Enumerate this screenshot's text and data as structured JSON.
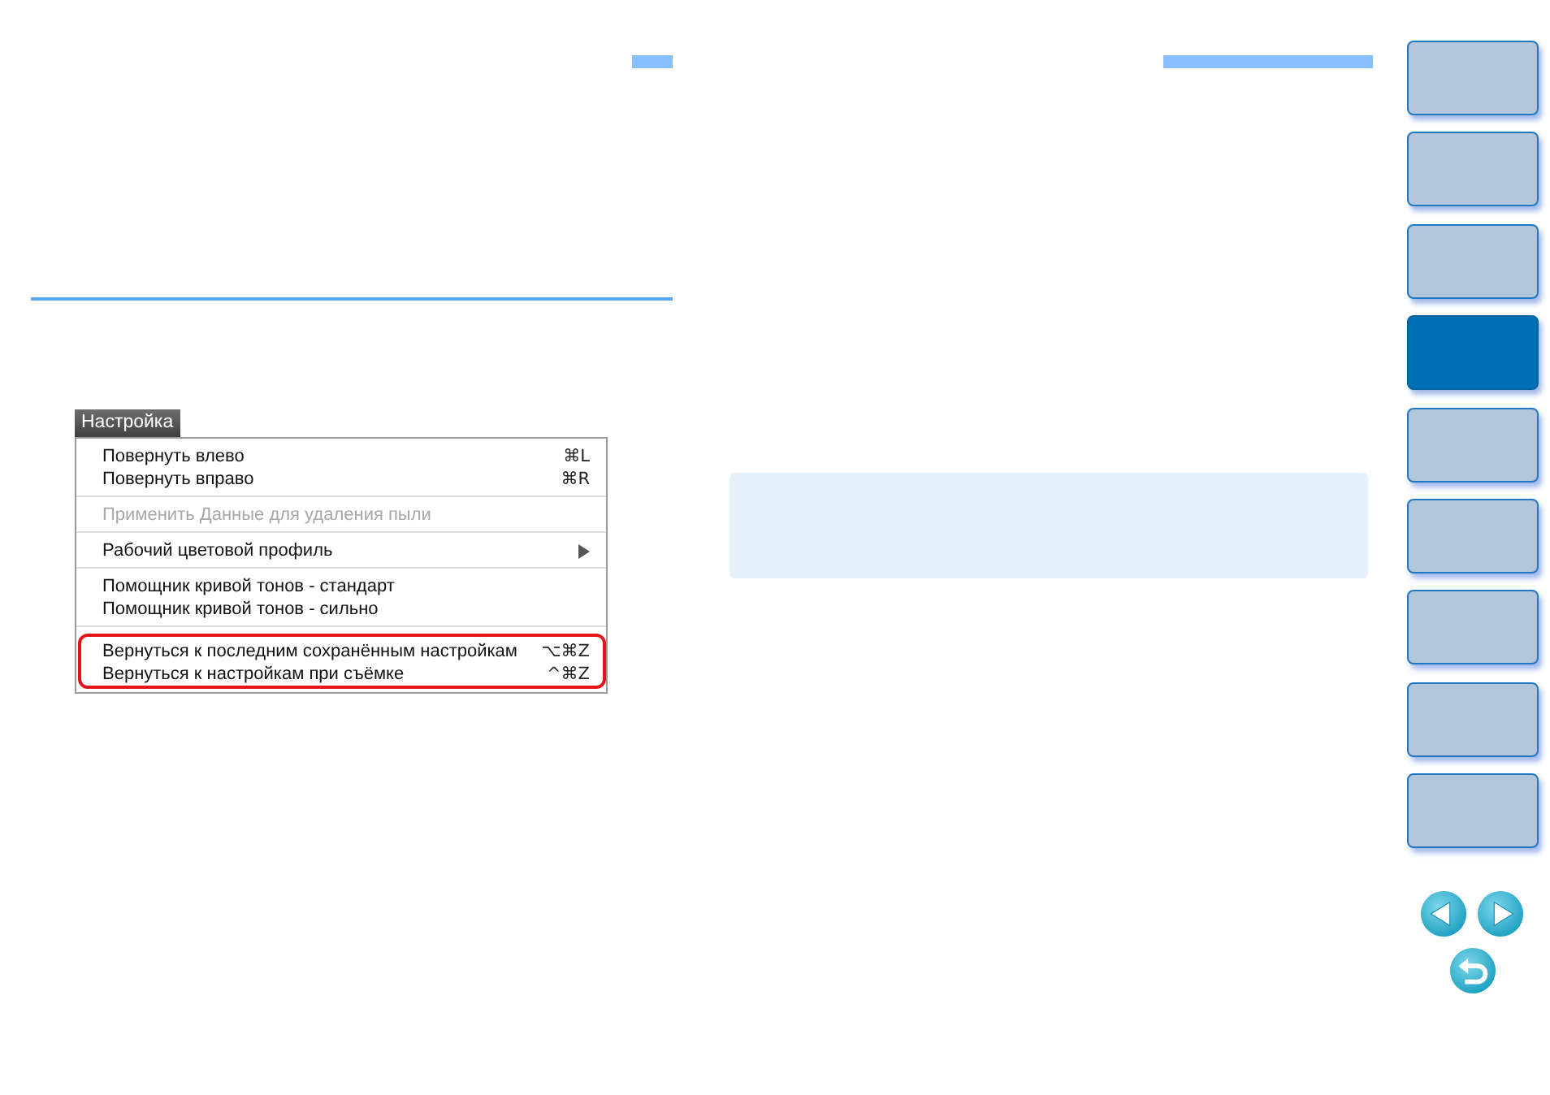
{
  "menu": {
    "title": "Настройка",
    "groups": [
      {
        "highlighted": false,
        "items": [
          {
            "label": "Повернуть влево",
            "shortcut": "⌘L",
            "disabled": false,
            "submenu": false
          },
          {
            "label": "Повернуть вправо",
            "shortcut": "⌘R",
            "disabled": false,
            "submenu": false
          }
        ]
      },
      {
        "highlighted": false,
        "items": [
          {
            "label": "Применить Данные для удаления пыли",
            "disabled": true,
            "submenu": false
          }
        ]
      },
      {
        "highlighted": false,
        "items": [
          {
            "label": "Рабочий цветовой профиль",
            "disabled": false,
            "submenu": true
          }
        ]
      },
      {
        "highlighted": false,
        "items": [
          {
            "label": "Помощник кривой тонов - стандарт",
            "disabled": false,
            "submenu": false
          },
          {
            "label": "Помощник кривой тонов - сильно",
            "disabled": false,
            "submenu": false
          }
        ]
      },
      {
        "highlighted": true,
        "items": [
          {
            "label": "Вернуться к последним сохранённым настройкам",
            "shortcut": "⌥⌘Z",
            "disabled": false,
            "submenu": false
          },
          {
            "label": "Вернуться к настройкам при съёмке",
            "shortcut": "^⌘Z",
            "disabled": false,
            "submenu": false
          }
        ]
      }
    ]
  },
  "nav_tabs": [
    {
      "selected": false
    },
    {
      "selected": false
    },
    {
      "selected": false
    },
    {
      "selected": true
    },
    {
      "selected": false
    },
    {
      "selected": false
    },
    {
      "selected": false
    },
    {
      "selected": false
    },
    {
      "selected": false
    }
  ]
}
